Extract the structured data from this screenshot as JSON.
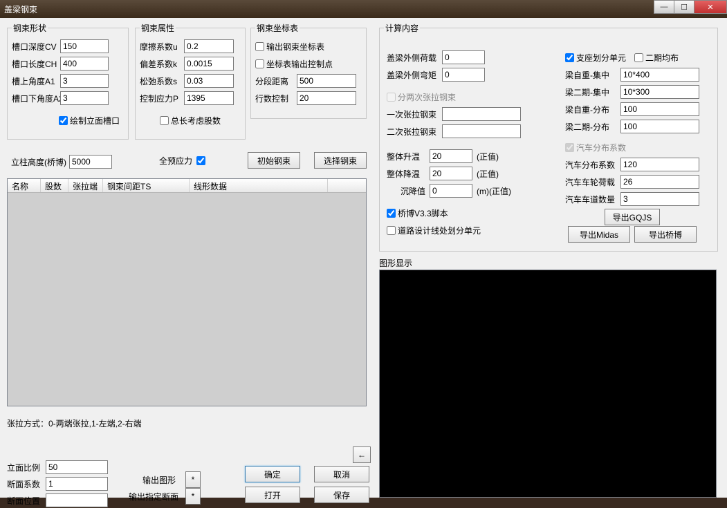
{
  "title": "盖梁钢束",
  "shape": {
    "legend": "钢束形状",
    "cv_lbl": "槽口深度CV",
    "cv": "150",
    "ch_lbl": "槽口长度CH",
    "ch": "400",
    "a1_lbl": "槽上角度A1",
    "a1": "3",
    "a2_lbl": "槽口下角度A2",
    "a2": "3",
    "draw_slot_lbl": "绘制立面槽口"
  },
  "attr": {
    "legend": "钢束属性",
    "mu_lbl": "摩擦系数u",
    "mu": "0.2",
    "k_lbl": "偏差系数k",
    "k": "0.0015",
    "s_lbl": "松弛系数s",
    "s": "0.03",
    "p_lbl": "控制应力P",
    "p": "1395",
    "strand_lbl": "总长考虑股数"
  },
  "coord": {
    "legend": "钢束坐标表",
    "out_tbl_lbl": "输出钢束坐标表",
    "ctrl_pt_lbl": "坐标表输出控制点",
    "seg_lbl": "分段距离",
    "seg": "500",
    "rows_lbl": "行数控制",
    "rows": "20"
  },
  "pier_h_lbl": "立柱高度(桥博)",
  "pier_h": "5000",
  "full_prestress_lbl": "全预应力",
  "btn_init": "初始钢束",
  "btn_select": "选择钢束",
  "list": {
    "h1": "名称",
    "h2": "股数",
    "h3": "张拉端",
    "h4": "钢束间距TS",
    "h5": "线形数据"
  },
  "pull_note": "张拉方式：0-两端张拉,1-左端,2-右端",
  "ratio_lbl": "立面比例",
  "ratio": "50",
  "sec_coef_lbl": "断面系数",
  "sec_coef": "1",
  "sec_pos_lbl": "断面位置",
  "sec_pos": "",
  "out_fig_lbl": "输出图形",
  "btn_star": "*",
  "out_spec_lbl": "输出指定断面",
  "btn_ok": "确定",
  "btn_cancel": "取消",
  "btn_open": "打开",
  "btn_save": "保存",
  "btn_arrow": "←",
  "calc": {
    "legend": "计算内容",
    "out_load_lbl": "盖梁外侧荷载",
    "out_load": "0",
    "out_moment_lbl": "盖梁外侧弯矩",
    "out_moment": "0",
    "split_twice_lbl": "分两次张拉钢束",
    "first_pull_lbl": "一次张拉钢束",
    "first_pull": "",
    "second_pull_lbl": "二次张拉钢束",
    "second_pull": "",
    "temp_up_lbl": "整体升温",
    "temp_up": "20",
    "pos_unit1": "(正值)",
    "temp_dn_lbl": "整体降温",
    "temp_dn": "20",
    "pos_unit2": "(正值)",
    "settle_lbl": "沉降值",
    "settle": "0",
    "settle_unit": "(m)(正值)",
    "qb_script_lbl": "桥博V3.3脚本",
    "road_line_lbl": "道路设计线处划分单元",
    "support_div_lbl": "支座划分单元",
    "phase2_uni_lbl": "二期均布",
    "sw_conc_lbl": "梁自重-集中",
    "sw_conc": "10*400",
    "p2_conc_lbl": "梁二期-集中",
    "p2_conc": "10*300",
    "sw_dist_lbl": "梁自重-分布",
    "sw_dist": "100",
    "p2_dist_lbl": "梁二期-分布",
    "p2_dist": "100",
    "veh_legend": "汽车分布系数",
    "veh_coef_lbl": "汽车分布系数",
    "veh_coef": "120",
    "wheel_lbl": "汽车车轮荷载",
    "wheel": "26",
    "lanes_lbl": "汽车车道数量",
    "lanes": "3",
    "btn_gqjs": "导出GQJS",
    "btn_midas": "导出Midas",
    "btn_qb": "导出桥博"
  },
  "display_lbl": "图形显示"
}
